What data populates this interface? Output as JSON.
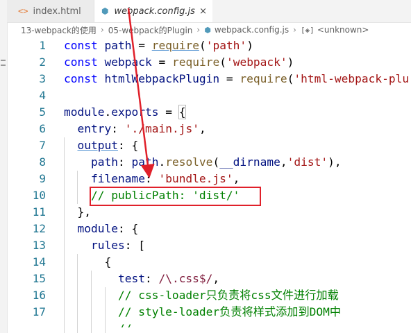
{
  "tabs": [
    {
      "label": "index.html",
      "icon": "html-icon",
      "active": false
    },
    {
      "label": "webpack.config.js",
      "icon": "webpack-js-icon",
      "active": true
    }
  ],
  "tab_close_glyph": "×",
  "breadcrumb": {
    "folder1": "13-webpack的使用",
    "folder2": "05-webpack的Plugin",
    "file": "webpack.config.js",
    "symbol": "<unknown>"
  },
  "code_lines": [
    {
      "num": "1",
      "text": "const path = require('path')"
    },
    {
      "num": "2",
      "text": "const webpack = require('webpack')"
    },
    {
      "num": "3",
      "text": "const htmlWebpackPlugin = require('html-webpack-plu"
    },
    {
      "num": "4",
      "text": ""
    },
    {
      "num": "5",
      "text": "module.exports = {"
    },
    {
      "num": "6",
      "text": "  entry: './main.js',"
    },
    {
      "num": "7",
      "text": "  output: {"
    },
    {
      "num": "8",
      "text": "    path: path.resolve(__dirname,'dist'),"
    },
    {
      "num": "9",
      "text": "    filename: 'bundle.js',"
    },
    {
      "num": "10",
      "text": "    // publicPath: 'dist/'"
    },
    {
      "num": "11",
      "text": "  },"
    },
    {
      "num": "12",
      "text": "  module: {"
    },
    {
      "num": "13",
      "text": "    rules: ["
    },
    {
      "num": "14",
      "text": "      {"
    },
    {
      "num": "15",
      "text": "        test: /\\.css$/,"
    },
    {
      "num": "16",
      "text": "        // css-loader只负责将css文件进行加载"
    },
    {
      "num": "17",
      "text": "        // style-loader负责将样式添加到DOM中"
    }
  ],
  "colors": {
    "keyword": "#0000ff",
    "string": "#a31515",
    "variable": "#001080",
    "function": "#795e26",
    "comment": "#008000",
    "line_number": "#237893",
    "annotation_red": "#e0202a"
  }
}
